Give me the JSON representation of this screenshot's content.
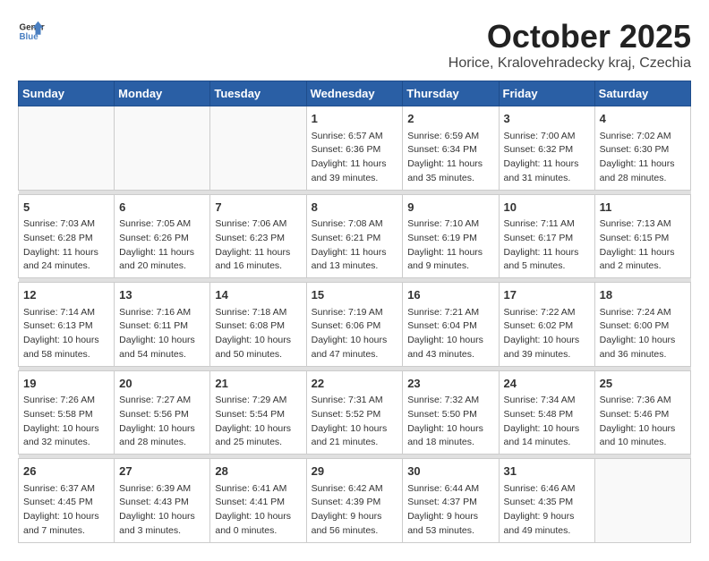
{
  "header": {
    "logo_general": "General",
    "logo_blue": "Blue",
    "month": "October 2025",
    "location": "Horice, Kralovehradecky kraj, Czechia"
  },
  "weekdays": [
    "Sunday",
    "Monday",
    "Tuesday",
    "Wednesday",
    "Thursday",
    "Friday",
    "Saturday"
  ],
  "weeks": [
    [
      {
        "day": "",
        "info": ""
      },
      {
        "day": "",
        "info": ""
      },
      {
        "day": "",
        "info": ""
      },
      {
        "day": "1",
        "info": "Sunrise: 6:57 AM\nSunset: 6:36 PM\nDaylight: 11 hours\nand 39 minutes."
      },
      {
        "day": "2",
        "info": "Sunrise: 6:59 AM\nSunset: 6:34 PM\nDaylight: 11 hours\nand 35 minutes."
      },
      {
        "day": "3",
        "info": "Sunrise: 7:00 AM\nSunset: 6:32 PM\nDaylight: 11 hours\nand 31 minutes."
      },
      {
        "day": "4",
        "info": "Sunrise: 7:02 AM\nSunset: 6:30 PM\nDaylight: 11 hours\nand 28 minutes."
      }
    ],
    [
      {
        "day": "5",
        "info": "Sunrise: 7:03 AM\nSunset: 6:28 PM\nDaylight: 11 hours\nand 24 minutes."
      },
      {
        "day": "6",
        "info": "Sunrise: 7:05 AM\nSunset: 6:26 PM\nDaylight: 11 hours\nand 20 minutes."
      },
      {
        "day": "7",
        "info": "Sunrise: 7:06 AM\nSunset: 6:23 PM\nDaylight: 11 hours\nand 16 minutes."
      },
      {
        "day": "8",
        "info": "Sunrise: 7:08 AM\nSunset: 6:21 PM\nDaylight: 11 hours\nand 13 minutes."
      },
      {
        "day": "9",
        "info": "Sunrise: 7:10 AM\nSunset: 6:19 PM\nDaylight: 11 hours\nand 9 minutes."
      },
      {
        "day": "10",
        "info": "Sunrise: 7:11 AM\nSunset: 6:17 PM\nDaylight: 11 hours\nand 5 minutes."
      },
      {
        "day": "11",
        "info": "Sunrise: 7:13 AM\nSunset: 6:15 PM\nDaylight: 11 hours\nand 2 minutes."
      }
    ],
    [
      {
        "day": "12",
        "info": "Sunrise: 7:14 AM\nSunset: 6:13 PM\nDaylight: 10 hours\nand 58 minutes."
      },
      {
        "day": "13",
        "info": "Sunrise: 7:16 AM\nSunset: 6:11 PM\nDaylight: 10 hours\nand 54 minutes."
      },
      {
        "day": "14",
        "info": "Sunrise: 7:18 AM\nSunset: 6:08 PM\nDaylight: 10 hours\nand 50 minutes."
      },
      {
        "day": "15",
        "info": "Sunrise: 7:19 AM\nSunset: 6:06 PM\nDaylight: 10 hours\nand 47 minutes."
      },
      {
        "day": "16",
        "info": "Sunrise: 7:21 AM\nSunset: 6:04 PM\nDaylight: 10 hours\nand 43 minutes."
      },
      {
        "day": "17",
        "info": "Sunrise: 7:22 AM\nSunset: 6:02 PM\nDaylight: 10 hours\nand 39 minutes."
      },
      {
        "day": "18",
        "info": "Sunrise: 7:24 AM\nSunset: 6:00 PM\nDaylight: 10 hours\nand 36 minutes."
      }
    ],
    [
      {
        "day": "19",
        "info": "Sunrise: 7:26 AM\nSunset: 5:58 PM\nDaylight: 10 hours\nand 32 minutes."
      },
      {
        "day": "20",
        "info": "Sunrise: 7:27 AM\nSunset: 5:56 PM\nDaylight: 10 hours\nand 28 minutes."
      },
      {
        "day": "21",
        "info": "Sunrise: 7:29 AM\nSunset: 5:54 PM\nDaylight: 10 hours\nand 25 minutes."
      },
      {
        "day": "22",
        "info": "Sunrise: 7:31 AM\nSunset: 5:52 PM\nDaylight: 10 hours\nand 21 minutes."
      },
      {
        "day": "23",
        "info": "Sunrise: 7:32 AM\nSunset: 5:50 PM\nDaylight: 10 hours\nand 18 minutes."
      },
      {
        "day": "24",
        "info": "Sunrise: 7:34 AM\nSunset: 5:48 PM\nDaylight: 10 hours\nand 14 minutes."
      },
      {
        "day": "25",
        "info": "Sunrise: 7:36 AM\nSunset: 5:46 PM\nDaylight: 10 hours\nand 10 minutes."
      }
    ],
    [
      {
        "day": "26",
        "info": "Sunrise: 6:37 AM\nSunset: 4:45 PM\nDaylight: 10 hours\nand 7 minutes."
      },
      {
        "day": "27",
        "info": "Sunrise: 6:39 AM\nSunset: 4:43 PM\nDaylight: 10 hours\nand 3 minutes."
      },
      {
        "day": "28",
        "info": "Sunrise: 6:41 AM\nSunset: 4:41 PM\nDaylight: 10 hours\nand 0 minutes."
      },
      {
        "day": "29",
        "info": "Sunrise: 6:42 AM\nSunset: 4:39 PM\nDaylight: 9 hours\nand 56 minutes."
      },
      {
        "day": "30",
        "info": "Sunrise: 6:44 AM\nSunset: 4:37 PM\nDaylight: 9 hours\nand 53 minutes."
      },
      {
        "day": "31",
        "info": "Sunrise: 6:46 AM\nSunset: 4:35 PM\nDaylight: 9 hours\nand 49 minutes."
      },
      {
        "day": "",
        "info": ""
      }
    ]
  ]
}
